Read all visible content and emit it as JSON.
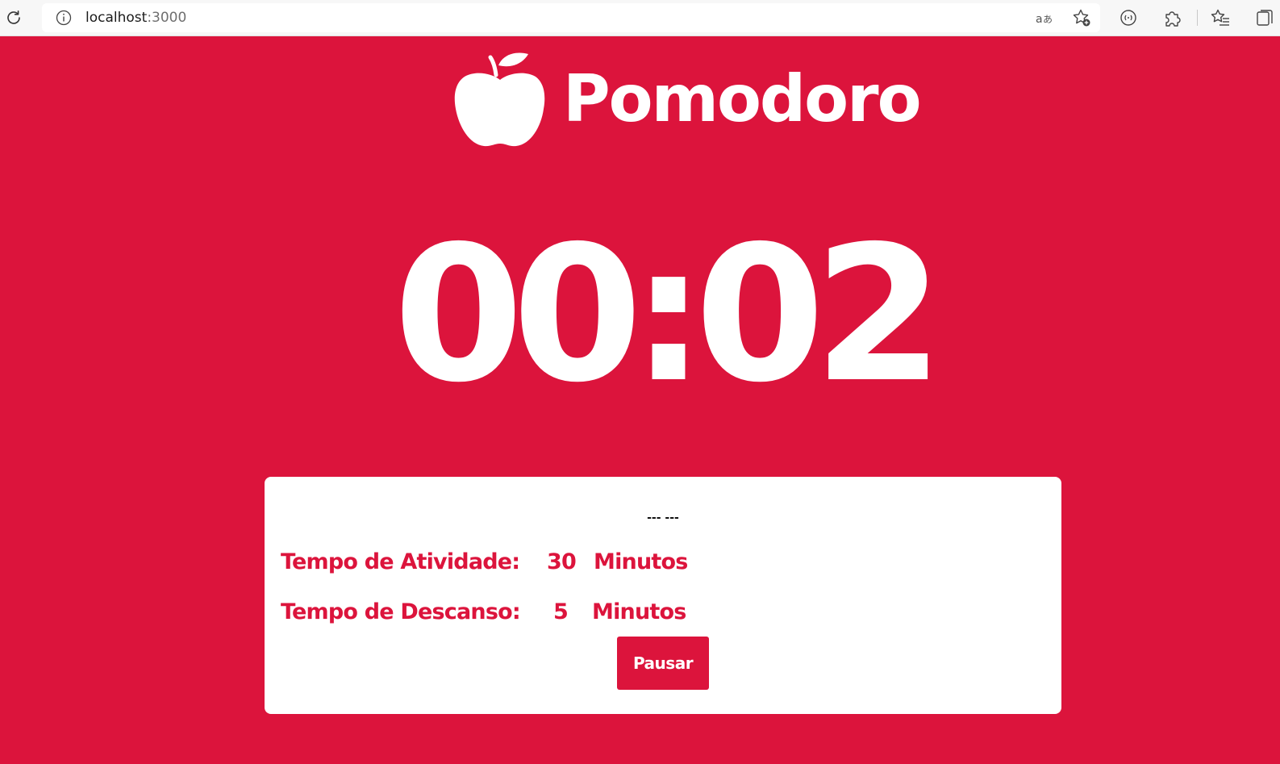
{
  "browser": {
    "url_host": "localhost",
    "url_port": ":3000",
    "icons": [
      "reload-icon",
      "info-icon",
      "read-aloud-icon",
      "add-favorite-icon",
      "browser-essentials-icon",
      "extensions-icon",
      "favorites-icon",
      "collections-icon"
    ]
  },
  "app": {
    "title": "Pomodoro",
    "logo_icon": "apple-icon",
    "timer": "00:02",
    "status_text": "--- ---",
    "activity_label": "Tempo de Atividade:",
    "activity_value": "30",
    "activity_unit": "Minutos",
    "rest_label": "Tempo de Descanso:",
    "rest_value": "5",
    "rest_unit": "Minutos",
    "pause_button_label": "Pausar"
  },
  "colors": {
    "accent": "#dc143c",
    "card": "#ffffff",
    "text_on_accent": "#ffffff"
  }
}
